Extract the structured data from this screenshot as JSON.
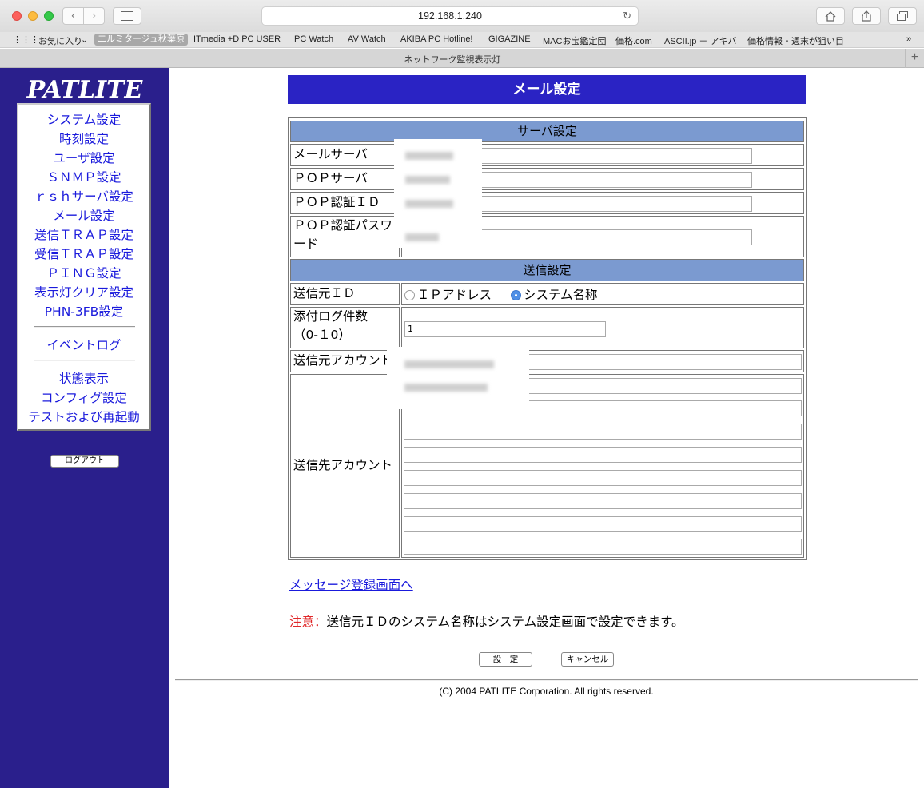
{
  "browser": {
    "url": "192.168.1.240",
    "tab_title": "ネットワーク監視表示灯",
    "bookmarks": [
      "お気に入り",
      "エルミタージュ秋葉原",
      "ITmedia +D PC USER",
      "PC Watch",
      "AV Watch",
      "AKIBA PC Hotline!",
      "GIGAZINE",
      "MACお宝鑑定団",
      "価格.com",
      "ASCII.jp － アキバ",
      "価格情報・週末が狙い目"
    ]
  },
  "sidebar": {
    "logo": "PATLITE",
    "items": [
      "システム設定",
      "時刻設定",
      "ユーザ設定",
      "ＳＮＭＰ設定",
      "ｒｓｈサーバ設定",
      "メール設定",
      "送信ＴＲＡＰ設定",
      "受信ＴＲＡＰ設定",
      "ＰＩＮＧ設定",
      "表示灯クリア設定",
      "PHN-3FB設定"
    ],
    "items2": [
      "イベントログ"
    ],
    "items3": [
      "状態表示",
      "コンフィグ設定",
      "テストおよび再起動"
    ],
    "logout": "ログアウト"
  },
  "main": {
    "title": "メール設定",
    "server_header": "サーバ設定",
    "mail_server": "メールサーバ",
    "pop_server": "ＰＯＰサーバ",
    "pop_auth_id": "ＰＯＰ認証ＩＤ",
    "pop_auth_password_1": "ＰＯＰ認証パスワ",
    "pop_auth_password_2": "ード",
    "send_header": "送信設定",
    "sender_id": "送信元ＩＤ",
    "radio_ip": "ＩＰアドレス",
    "radio_system": "システム名称",
    "log_count_1": "添付ログ件数",
    "log_count_2": "（0-１0）",
    "log_count_value": "1",
    "sender_account": "送信元アカウント",
    "recipient_account": "送信先アカウント",
    "message_link": "メッセージ登録画面へ",
    "note_head": "注意：",
    "note_body": "送信元ＩＤのシステム名称はシステム設定画面で設定できます。",
    "save_button": "設　定",
    "cancel_button": "キャンセル",
    "copyright": "(C) 2004 PATLITE Corporation. All rights reserved."
  }
}
